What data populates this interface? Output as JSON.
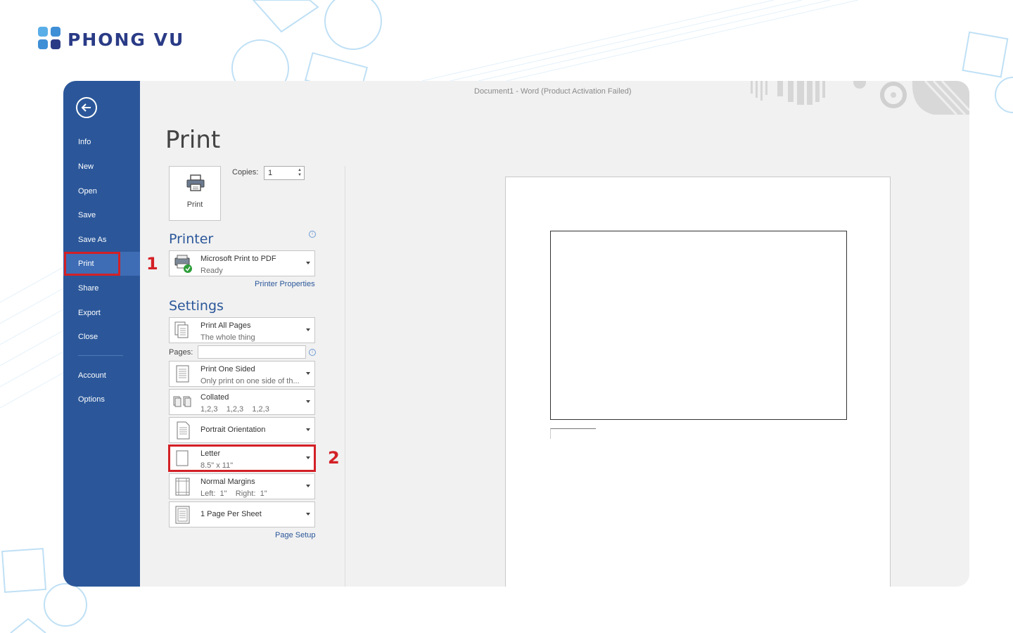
{
  "brand": {
    "name": "PHONG VU",
    "primary": "#2a3b86",
    "accent": "#3f9fe0"
  },
  "window": {
    "title": "Document1 - Word (Product Activation Failed)"
  },
  "colors": {
    "sidebar": "#2b579a",
    "sidebar_active": "#3e6db5",
    "highlight": "#d32026"
  },
  "sidebar": {
    "back_icon": "back-arrow-icon",
    "items": [
      {
        "label": "Info"
      },
      {
        "label": "New"
      },
      {
        "label": "Open"
      },
      {
        "label": "Save"
      },
      {
        "label": "Save As"
      },
      {
        "label": "Print",
        "active": true
      },
      {
        "label": "Share"
      },
      {
        "label": "Export"
      },
      {
        "label": "Close"
      },
      {
        "label": "Account"
      },
      {
        "label": "Options"
      }
    ]
  },
  "main": {
    "heading": "Print",
    "print_button": {
      "label": "Print",
      "icon": "printer-icon"
    },
    "copies": {
      "label": "Copies:",
      "value": "1"
    },
    "printer": {
      "section_title": "Printer",
      "name": "Microsoft Print to PDF",
      "status": "Ready",
      "properties_link": "Printer Properties"
    },
    "settings": {
      "section_title": "Settings",
      "pages_label": "Pages:",
      "pages_value": "",
      "options": [
        {
          "line1": "Print All Pages",
          "line2": "The whole thing",
          "icon": "pages-icon"
        },
        {
          "line1": "Print One Sided",
          "line2": "Only print on one side of th...",
          "icon": "one-sided-icon"
        },
        {
          "line1": "Collated",
          "line2": "1,2,3    1,2,3    1,2,3",
          "icon": "collated-icon"
        },
        {
          "line1": "Portrait Orientation",
          "icon": "portrait-icon"
        },
        {
          "line1": "Letter",
          "line2": "8.5\" x 11\"",
          "icon": "paper-size-icon"
        },
        {
          "line1": "Normal Margins",
          "line2": "Left:  1\"    Right:  1\"",
          "icon": "margins-icon"
        },
        {
          "line1": "1 Page Per Sheet",
          "icon": "pages-per-sheet-icon"
        }
      ],
      "page_setup_link": "Page Setup"
    }
  },
  "annotations": {
    "step1": "1",
    "step2": "2"
  }
}
